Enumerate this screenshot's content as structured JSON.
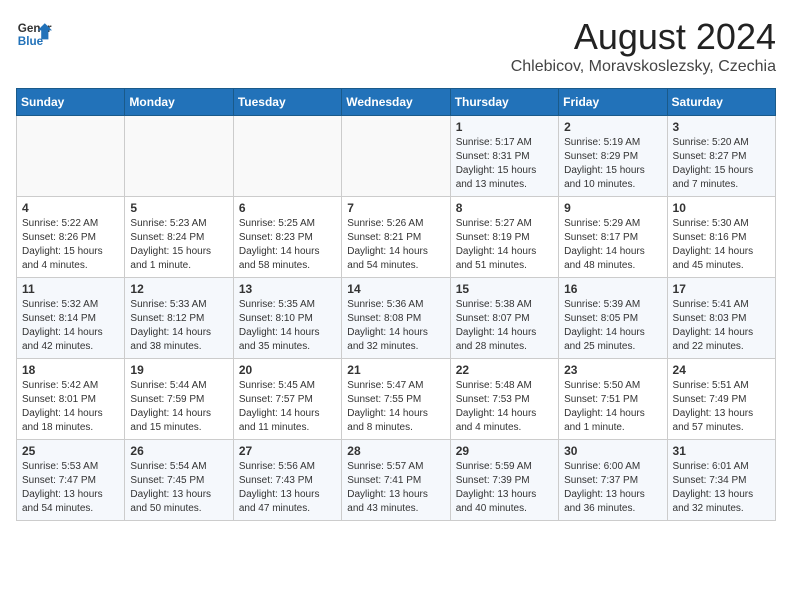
{
  "header": {
    "logo_line1": "General",
    "logo_line2": "Blue",
    "month": "August 2024",
    "location": "Chlebicov, Moravskoslezsky, Czechia"
  },
  "weekdays": [
    "Sunday",
    "Monday",
    "Tuesday",
    "Wednesday",
    "Thursday",
    "Friday",
    "Saturday"
  ],
  "weeks": [
    [
      {
        "day": "",
        "info": ""
      },
      {
        "day": "",
        "info": ""
      },
      {
        "day": "",
        "info": ""
      },
      {
        "day": "",
        "info": ""
      },
      {
        "day": "1",
        "info": "Sunrise: 5:17 AM\nSunset: 8:31 PM\nDaylight: 15 hours\nand 13 minutes."
      },
      {
        "day": "2",
        "info": "Sunrise: 5:19 AM\nSunset: 8:29 PM\nDaylight: 15 hours\nand 10 minutes."
      },
      {
        "day": "3",
        "info": "Sunrise: 5:20 AM\nSunset: 8:27 PM\nDaylight: 15 hours\nand 7 minutes."
      }
    ],
    [
      {
        "day": "4",
        "info": "Sunrise: 5:22 AM\nSunset: 8:26 PM\nDaylight: 15 hours\nand 4 minutes."
      },
      {
        "day": "5",
        "info": "Sunrise: 5:23 AM\nSunset: 8:24 PM\nDaylight: 15 hours\nand 1 minute."
      },
      {
        "day": "6",
        "info": "Sunrise: 5:25 AM\nSunset: 8:23 PM\nDaylight: 14 hours\nand 58 minutes."
      },
      {
        "day": "7",
        "info": "Sunrise: 5:26 AM\nSunset: 8:21 PM\nDaylight: 14 hours\nand 54 minutes."
      },
      {
        "day": "8",
        "info": "Sunrise: 5:27 AM\nSunset: 8:19 PM\nDaylight: 14 hours\nand 51 minutes."
      },
      {
        "day": "9",
        "info": "Sunrise: 5:29 AM\nSunset: 8:17 PM\nDaylight: 14 hours\nand 48 minutes."
      },
      {
        "day": "10",
        "info": "Sunrise: 5:30 AM\nSunset: 8:16 PM\nDaylight: 14 hours\nand 45 minutes."
      }
    ],
    [
      {
        "day": "11",
        "info": "Sunrise: 5:32 AM\nSunset: 8:14 PM\nDaylight: 14 hours\nand 42 minutes."
      },
      {
        "day": "12",
        "info": "Sunrise: 5:33 AM\nSunset: 8:12 PM\nDaylight: 14 hours\nand 38 minutes."
      },
      {
        "day": "13",
        "info": "Sunrise: 5:35 AM\nSunset: 8:10 PM\nDaylight: 14 hours\nand 35 minutes."
      },
      {
        "day": "14",
        "info": "Sunrise: 5:36 AM\nSunset: 8:08 PM\nDaylight: 14 hours\nand 32 minutes."
      },
      {
        "day": "15",
        "info": "Sunrise: 5:38 AM\nSunset: 8:07 PM\nDaylight: 14 hours\nand 28 minutes."
      },
      {
        "day": "16",
        "info": "Sunrise: 5:39 AM\nSunset: 8:05 PM\nDaylight: 14 hours\nand 25 minutes."
      },
      {
        "day": "17",
        "info": "Sunrise: 5:41 AM\nSunset: 8:03 PM\nDaylight: 14 hours\nand 22 minutes."
      }
    ],
    [
      {
        "day": "18",
        "info": "Sunrise: 5:42 AM\nSunset: 8:01 PM\nDaylight: 14 hours\nand 18 minutes."
      },
      {
        "day": "19",
        "info": "Sunrise: 5:44 AM\nSunset: 7:59 PM\nDaylight: 14 hours\nand 15 minutes."
      },
      {
        "day": "20",
        "info": "Sunrise: 5:45 AM\nSunset: 7:57 PM\nDaylight: 14 hours\nand 11 minutes."
      },
      {
        "day": "21",
        "info": "Sunrise: 5:47 AM\nSunset: 7:55 PM\nDaylight: 14 hours\nand 8 minutes."
      },
      {
        "day": "22",
        "info": "Sunrise: 5:48 AM\nSunset: 7:53 PM\nDaylight: 14 hours\nand 4 minutes."
      },
      {
        "day": "23",
        "info": "Sunrise: 5:50 AM\nSunset: 7:51 PM\nDaylight: 14 hours\nand 1 minute."
      },
      {
        "day": "24",
        "info": "Sunrise: 5:51 AM\nSunset: 7:49 PM\nDaylight: 13 hours\nand 57 minutes."
      }
    ],
    [
      {
        "day": "25",
        "info": "Sunrise: 5:53 AM\nSunset: 7:47 PM\nDaylight: 13 hours\nand 54 minutes."
      },
      {
        "day": "26",
        "info": "Sunrise: 5:54 AM\nSunset: 7:45 PM\nDaylight: 13 hours\nand 50 minutes."
      },
      {
        "day": "27",
        "info": "Sunrise: 5:56 AM\nSunset: 7:43 PM\nDaylight: 13 hours\nand 47 minutes."
      },
      {
        "day": "28",
        "info": "Sunrise: 5:57 AM\nSunset: 7:41 PM\nDaylight: 13 hours\nand 43 minutes."
      },
      {
        "day": "29",
        "info": "Sunrise: 5:59 AM\nSunset: 7:39 PM\nDaylight: 13 hours\nand 40 minutes."
      },
      {
        "day": "30",
        "info": "Sunrise: 6:00 AM\nSunset: 7:37 PM\nDaylight: 13 hours\nand 36 minutes."
      },
      {
        "day": "31",
        "info": "Sunrise: 6:01 AM\nSunset: 7:34 PM\nDaylight: 13 hours\nand 32 minutes."
      }
    ]
  ]
}
